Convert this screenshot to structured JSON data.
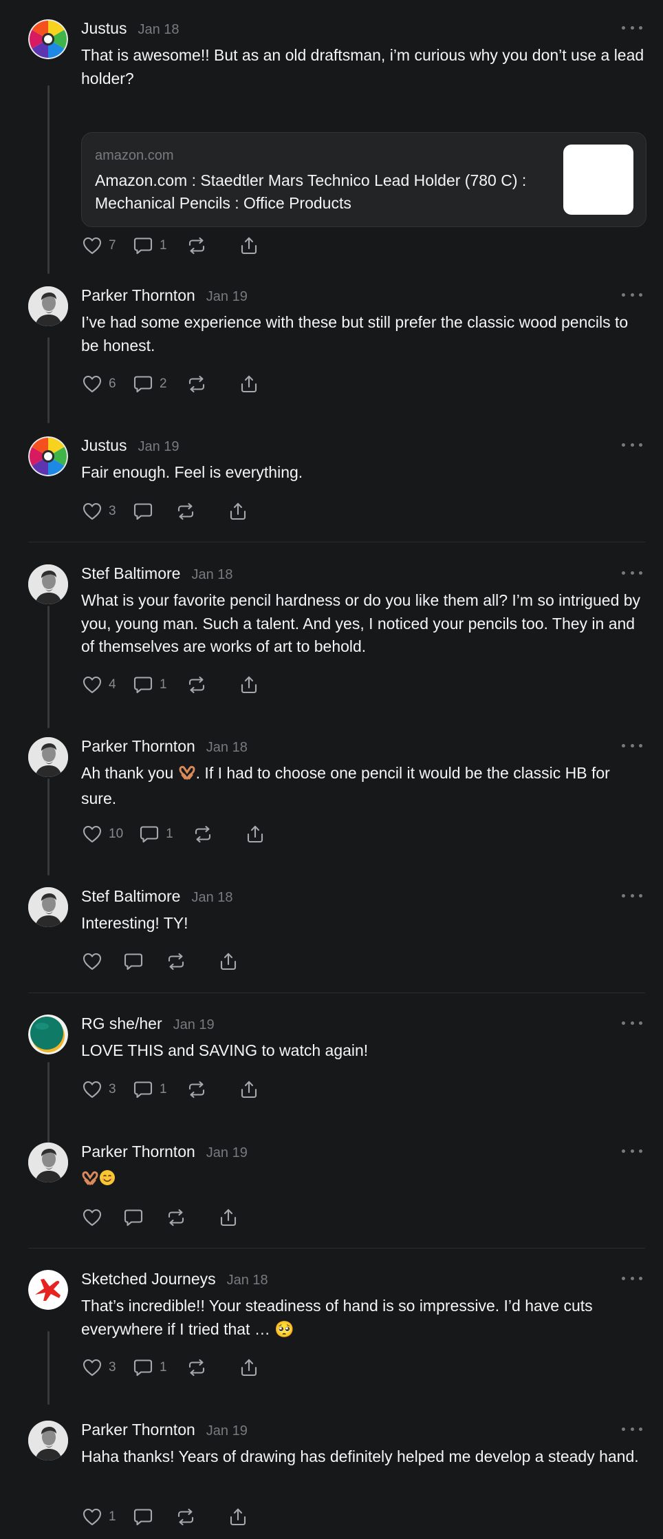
{
  "posts": [
    {
      "username": "Justus",
      "time": "Jan 18",
      "avatar_icon": "color-wheel-icon",
      "text": "That is awesome!! But as an old draftsman, i’m curious why you don’t use a lead holder?",
      "link_card": {
        "domain": "amazon.com",
        "title": "Amazon.com : Staedtler Mars Technico Lead Holder (780 C) : Mechanical Pencils : Office Products"
      },
      "likes": "7",
      "replies": "1"
    },
    {
      "username": "Parker Thornton",
      "time": "Jan 19",
      "avatar_icon": "profile-photo",
      "text": "I’ve had some experience with these but still prefer the classic wood pencils to be honest.",
      "likes": "6",
      "replies": "2"
    },
    {
      "username": "Justus",
      "time": "Jan 19",
      "avatar_icon": "color-wheel-icon",
      "text": "Fair enough. Feel is everything.",
      "likes": "3",
      "replies": ""
    },
    {
      "username": "Stef Baltimore",
      "time": "Jan 18",
      "avatar_icon": "profile-photo",
      "text": "What is your favorite pencil hardness or do you like them all? I’m so intrigued by you, young man. Such a talent. And yes, I noticed your pencils too. They in and of themselves are works of art to behold.",
      "likes": "4",
      "replies": "1"
    },
    {
      "username": "Parker Thornton",
      "time": "Jan 18",
      "avatar_icon": "profile-photo",
      "text_before_emoji": "Ah thank you ",
      "emoji": "heart-hands",
      "text_after_emoji": ". If I had to choose one pencil it would be the classic HB for sure.",
      "likes": "10",
      "replies": "1"
    },
    {
      "username": "Stef Baltimore",
      "time": "Jan 18",
      "avatar_icon": "profile-photo",
      "text": "Interesting! TY!",
      "likes": "",
      "replies": ""
    },
    {
      "username": "RG she/her",
      "time": "Jan 19",
      "avatar_icon": "green-circle-avatar",
      "text": "LOVE THIS and SAVING to watch again!",
      "likes": "3",
      "replies": "1"
    },
    {
      "username": "Parker Thornton",
      "time": "Jan 19",
      "avatar_icon": "profile-photo",
      "emojis": [
        "heart-hands",
        "smiling-face"
      ],
      "likes": "",
      "replies": ""
    },
    {
      "username": "Sketched Journeys",
      "time": "Jan 18",
      "avatar_icon": "red-airplane-logo",
      "text": "That’s incredible!! Your steadiness of hand is so impressive. I’d have cuts everywhere if I tried that … 🥺",
      "likes": "3",
      "replies": "1"
    },
    {
      "username": "Parker Thornton",
      "time": "Jan 19",
      "avatar_icon": "profile-photo",
      "text": "Haha thanks! Years of drawing has definitely helped me develop a steady hand.",
      "likes": "1",
      "replies": ""
    }
  ],
  "colors": {
    "background": "#17181a",
    "text": "#f3f5f7",
    "secondary": "#7a7a7e",
    "thread_line": "#39393c"
  }
}
